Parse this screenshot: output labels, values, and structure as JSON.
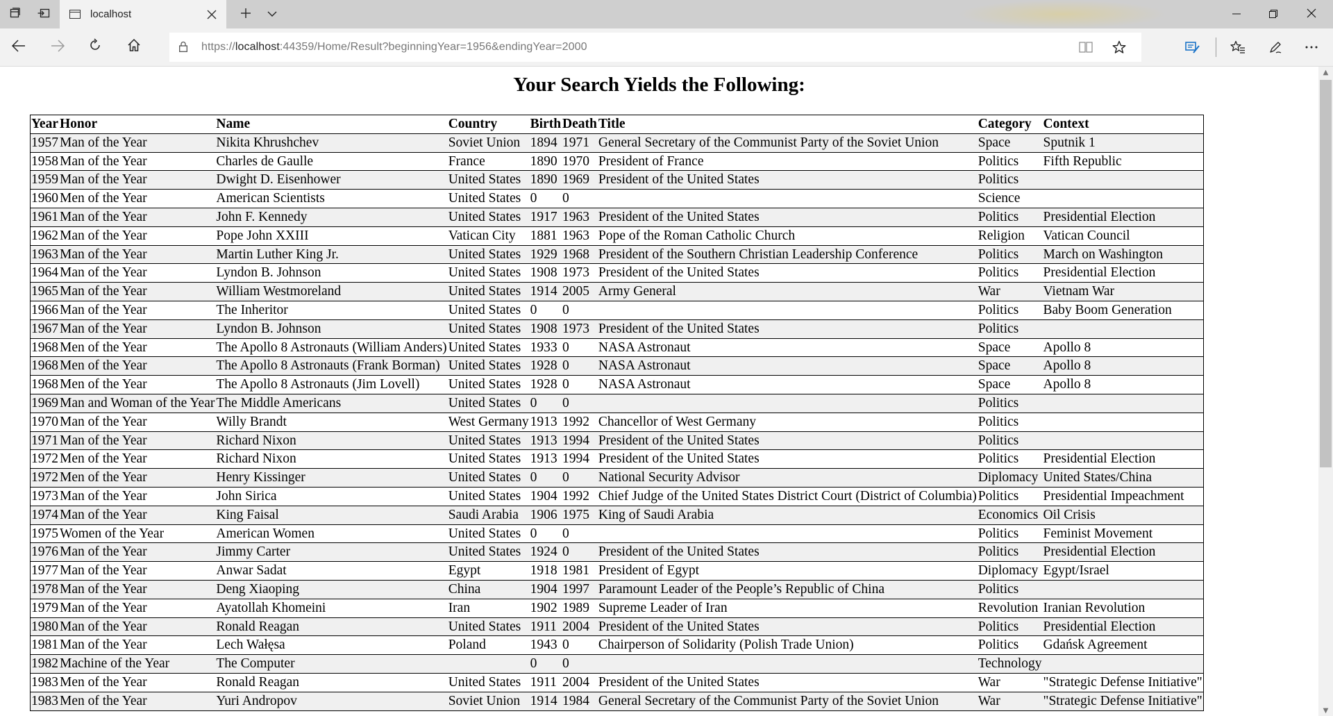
{
  "browser": {
    "tab": {
      "title": "localhost"
    },
    "address": {
      "scheme": "https://",
      "host": "localhost",
      "rest": ":44359/Home/Result?beginningYear=1956&endingYear=2000"
    }
  },
  "page": {
    "title": "Your Search Yields the Following:",
    "columns": [
      "Year",
      "Honor",
      "Name",
      "Country",
      "Birth",
      "Death",
      "Title",
      "Category",
      "Context"
    ],
    "rows": [
      [
        "1957",
        "Man of the Year",
        "Nikita Khrushchev",
        "Soviet Union",
        "1894",
        "1971",
        "General Secretary of the Communist Party of the Soviet Union",
        "Space",
        "Sputnik 1"
      ],
      [
        "1958",
        "Man of the Year",
        "Charles de Gaulle",
        "France",
        "1890",
        "1970",
        "President of France",
        "Politics",
        "Fifth Republic"
      ],
      [
        "1959",
        "Man of the Year",
        "Dwight D. Eisenhower",
        "United States",
        "1890",
        "1969",
        "President of the United States",
        "Politics",
        ""
      ],
      [
        "1960",
        "Men of the Year",
        "American Scientists",
        "United States",
        "0",
        "0",
        "",
        "Science",
        ""
      ],
      [
        "1961",
        "Man of the Year",
        "John F. Kennedy",
        "United States",
        "1917",
        "1963",
        "President of the United States",
        "Politics",
        "Presidential Election"
      ],
      [
        "1962",
        "Man of the Year",
        "Pope John XXIII",
        "Vatican City",
        "1881",
        "1963",
        "Pope of the Roman Catholic Church",
        "Religion",
        "Vatican Council"
      ],
      [
        "1963",
        "Man of the Year",
        "Martin Luther King Jr.",
        "United States",
        "1929",
        "1968",
        "President of the Southern Christian Leadership Conference",
        "Politics",
        "March on Washington"
      ],
      [
        "1964",
        "Man of the Year",
        "Lyndon B. Johnson",
        "United States",
        "1908",
        "1973",
        "President of the United States",
        "Politics",
        "Presidential Election"
      ],
      [
        "1965",
        "Man of the Year",
        "William Westmoreland",
        "United States",
        "1914",
        "2005",
        "Army General",
        "War",
        "Vietnam War"
      ],
      [
        "1966",
        "Man of the Year",
        "The Inheritor",
        "United States",
        "0",
        "0",
        "",
        "Politics",
        "Baby Boom Generation"
      ],
      [
        "1967",
        "Man of the Year",
        "Lyndon B. Johnson",
        "United States",
        "1908",
        "1973",
        "President of the United States",
        "Politics",
        ""
      ],
      [
        "1968",
        "Men of the Year",
        "The Apollo 8 Astronauts (William Anders)",
        "United States",
        "1933",
        "0",
        "NASA Astronaut",
        "Space",
        "Apollo 8"
      ],
      [
        "1968",
        "Men of the Year",
        "The Apollo 8 Astronauts (Frank Borman)",
        "United States",
        "1928",
        "0",
        "NASA Astronaut",
        "Space",
        "Apollo 8"
      ],
      [
        "1968",
        "Men of the Year",
        "The Apollo 8 Astronauts (Jim Lovell)",
        "United States",
        "1928",
        "0",
        "NASA Astronaut",
        "Space",
        "Apollo 8"
      ],
      [
        "1969",
        "Man and Woman of the Year",
        "The Middle Americans",
        "United States",
        "0",
        "0",
        "",
        "Politics",
        ""
      ],
      [
        "1970",
        "Man of the Year",
        "Willy Brandt",
        "West Germany",
        "1913",
        "1992",
        "Chancellor of West Germany",
        "Politics",
        ""
      ],
      [
        "1971",
        "Man of the Year",
        "Richard Nixon",
        "United States",
        "1913",
        "1994",
        "President of the United States",
        "Politics",
        ""
      ],
      [
        "1972",
        "Men of the Year",
        "Richard Nixon",
        "United States",
        "1913",
        "1994",
        "President of the United States",
        "Politics",
        "Presidential Election"
      ],
      [
        "1972",
        "Men of the Year",
        "Henry Kissinger",
        "United States",
        "0",
        "0",
        "National Security Advisor",
        "Diplomacy",
        "United States/China"
      ],
      [
        "1973",
        "Man of the Year",
        "John Sirica",
        "United States",
        "1904",
        "1992",
        "Chief Judge of the United States District Court (District of Columbia)",
        "Politics",
        "Presidential Impeachment"
      ],
      [
        "1974",
        "Man of the Year",
        "King Faisal",
        "Saudi Arabia",
        "1906",
        "1975",
        "King of Saudi Arabia",
        "Economics",
        "Oil Crisis"
      ],
      [
        "1975",
        "Women of the Year",
        "American Women",
        "United States",
        "0",
        "0",
        "",
        "Politics",
        "Feminist Movement"
      ],
      [
        "1976",
        "Man of the Year",
        "Jimmy Carter",
        "United States",
        "1924",
        "0",
        "President of the United States",
        "Politics",
        "Presidential Election"
      ],
      [
        "1977",
        "Man of the Year",
        "Anwar Sadat",
        "Egypt",
        "1918",
        "1981",
        "President of Egypt",
        "Diplomacy",
        "Egypt/Israel"
      ],
      [
        "1978",
        "Man of the Year",
        "Deng Xiaoping",
        "China",
        "1904",
        "1997",
        "Paramount Leader of the People’s Republic of China",
        "Politics",
        ""
      ],
      [
        "1979",
        "Man of the Year",
        "Ayatollah Khomeini",
        "Iran",
        "1902",
        "1989",
        "Supreme Leader of Iran",
        "Revolution",
        "Iranian Revolution"
      ],
      [
        "1980",
        "Man of the Year",
        "Ronald Reagan",
        "United States",
        "1911",
        "2004",
        "President of the United States",
        "Politics",
        "Presidential Election"
      ],
      [
        "1981",
        "Man of the Year",
        "Lech Wałęsa",
        "Poland",
        "1943",
        "0",
        "Chairperson of Solidarity (Polish Trade Union)",
        "Politics",
        "Gdańsk Agreement"
      ],
      [
        "1982",
        "Machine of the Year",
        "The Computer",
        "",
        "0",
        "0",
        "",
        "Technology",
        ""
      ],
      [
        "1983",
        "Men of the Year",
        "Ronald Reagan",
        "United States",
        "1911",
        "2004",
        "President of the United States",
        "War",
        "\"Strategic Defense Initiative\""
      ],
      [
        "1983",
        "Men of the Year",
        "Yuri Andropov",
        "Soviet Union",
        "1914",
        "1984",
        "General Secretary of the Communist Party of the Soviet Union",
        "War",
        "\"Strategic Defense Initiative\""
      ]
    ]
  }
}
